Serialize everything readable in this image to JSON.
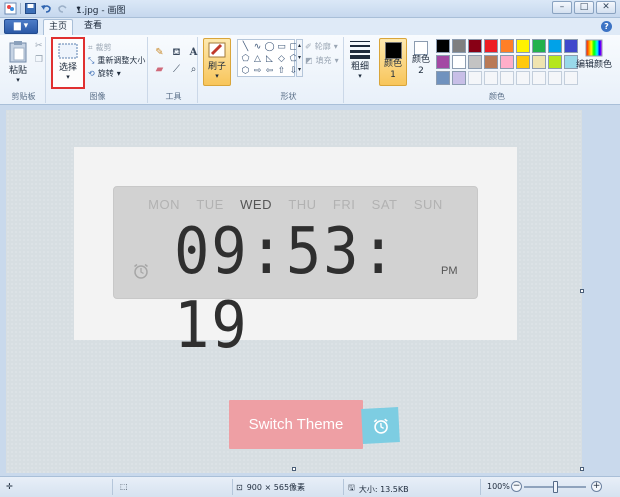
{
  "window": {
    "title": "1.jpg - 画图",
    "controls": {
      "minimize": "–",
      "maximize": "□",
      "close": "✕"
    }
  },
  "tabs": {
    "file": "▆ ▾",
    "home": "主页",
    "view": "查看",
    "help": "?"
  },
  "ribbon": {
    "clipboard": {
      "paste": "粘贴",
      "caption": "剪贴板"
    },
    "image": {
      "select": "选择",
      "crop": "裁剪",
      "resize": "重新调整大小",
      "rotate": "旋转",
      "caption": "图像"
    },
    "tools": {
      "caption": "工具"
    },
    "brushes": {
      "label": "刷子"
    },
    "shapes": {
      "outline": "轮廓",
      "fill": "填充",
      "caption": "形状"
    },
    "size": {
      "label": "粗细"
    },
    "colors": {
      "color1": "颜色 1",
      "color2": "颜色 2",
      "edit": "编辑颜色",
      "caption": "颜色",
      "swatches": [
        "#000000",
        "#7f7f7f",
        "#880015",
        "#ed1c24",
        "#ff7f27",
        "#fff200",
        "#22b14c",
        "#00a2e8",
        "#3f48cc",
        "#a349a4",
        "#ffffff",
        "#c3c3c3",
        "#b97a57",
        "#ffaec9",
        "#ffc90e",
        "#efe4b0",
        "#b5e61d",
        "#99d9ea",
        "#7092be",
        "#c8bfe7"
      ]
    }
  },
  "image_content": {
    "days": [
      "MON",
      "TUE",
      "WED",
      "THU",
      "FRI",
      "SAT",
      "SUN"
    ],
    "active_day": "WED",
    "time": "09:53: 19",
    "ampm": "PM",
    "switch_button": "Switch Theme"
  },
  "status": {
    "dimensions": "900 × 565像素",
    "file_size": "大小: 13.5KB",
    "zoom": "100%",
    "zoom_out": "−",
    "zoom_in": "+"
  }
}
